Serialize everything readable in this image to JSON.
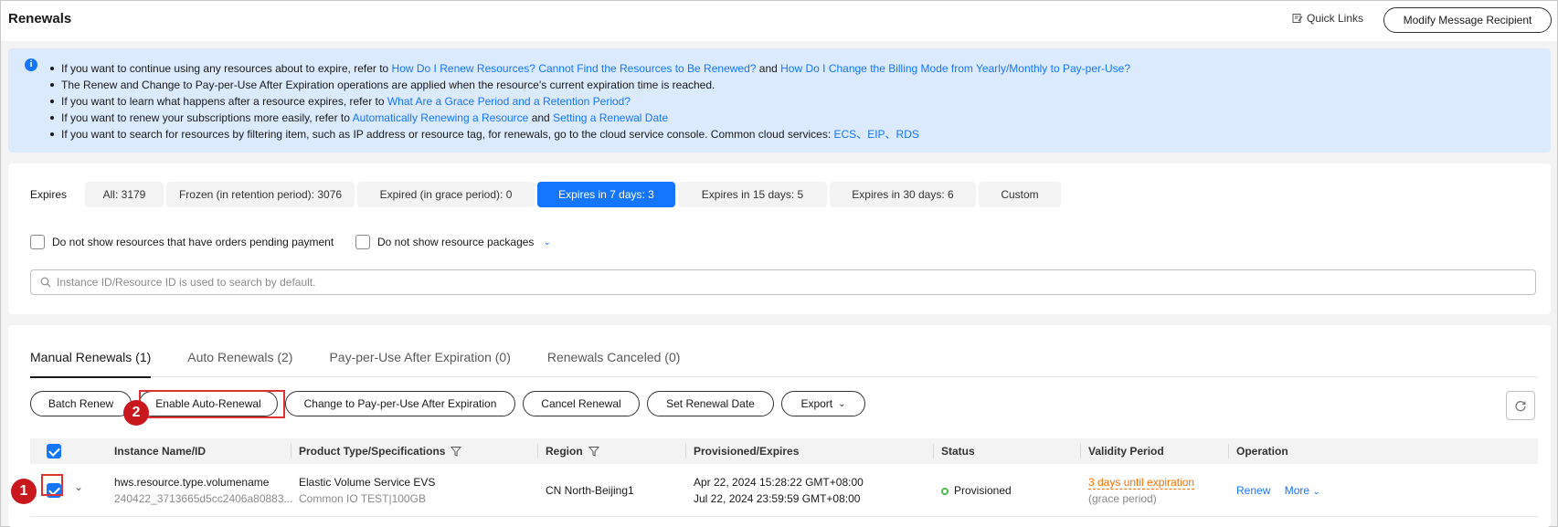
{
  "header": {
    "title": "Renewals",
    "quick_links": "Quick Links",
    "modify_recipient": "Modify Message Recipient"
  },
  "notice": {
    "line1_pre": "If you want to continue using any resources about to expire, refer to ",
    "line1_link1": "How Do I Renew Resources? Cannot Find the Resources to Be Renewed?",
    "line1_mid": " and ",
    "line1_link2": "How Do I Change the Billing Mode from Yearly/Monthly to Pay-per-Use?",
    "line2": "The Renew and Change to Pay-per-Use After Expiration operations are applied when the resource's current expiration time is reached.",
    "line3_pre": "If you want to learn what happens after a resource expires, refer to ",
    "line3_link": "What Are a Grace Period and a Retention Period?",
    "line4_pre": "If you want to renew your subscriptions more easily, refer to ",
    "line4_link1": "Automatically Renewing a Resource",
    "line4_mid": " and ",
    "line4_link2": "Setting a Renewal Date",
    "line5_pre": "If you want to search for resources by filtering item, such as IP address or resource tag, for renewals, go to the cloud service console. Common cloud services: ",
    "line5_links": "ECS、EIP、RDS"
  },
  "filters": {
    "expires_label": "Expires",
    "chips": [
      {
        "label": "All: 3179"
      },
      {
        "label": "Frozen (in retention period): 3076"
      },
      {
        "label": "Expired (in grace period): 0"
      },
      {
        "label": "Expires in 7 days: 3"
      },
      {
        "label": "Expires in 15 days: 5"
      },
      {
        "label": "Expires in 30 days: 6"
      },
      {
        "label": "Custom"
      }
    ],
    "option1": "Do not show resources that have orders pending payment",
    "option2": "Do not show resource packages",
    "search_placeholder": "Instance ID/Resource ID is used to search by default."
  },
  "tabs": [
    {
      "label": "Manual Renewals (1)"
    },
    {
      "label": "Auto Renewals (2)"
    },
    {
      "label": "Pay-per-Use After Expiration (0)"
    },
    {
      "label": "Renewals Canceled (0)"
    }
  ],
  "toolbar": {
    "batch_renew": "Batch Renew",
    "enable_auto_renewal": "Enable Auto-Renewal",
    "change_ppu": "Change to Pay-per-Use After Expiration",
    "cancel_renewal": "Cancel Renewal",
    "set_renewal_date": "Set Renewal Date",
    "export": "Export"
  },
  "table": {
    "columns": {
      "instance": "Instance Name/ID",
      "product": "Product Type/Specifications",
      "region": "Region",
      "provisioned": "Provisioned/Expires",
      "status": "Status",
      "validity": "Validity Period",
      "operation": "Operation"
    },
    "rows": [
      {
        "name": "hws.resource.type.volumename",
        "id": "240422_3713665d5cc2406a80883...",
        "product": "Elastic Volume Service EVS",
        "spec": "Common IO TEST|100GB",
        "region": "CN North-Beijing1",
        "provisioned": "Apr 22, 2024 15:28:22 GMT+08:00",
        "expires": "Jul 22, 2024 23:59:59 GMT+08:00",
        "status": "Provisioned",
        "validity": "3 days until expiration",
        "validity_note": "(grace period)",
        "renew": "Renew",
        "more": "More"
      }
    ]
  },
  "annotations": {
    "badge1": "1",
    "badge2": "2"
  },
  "colors": {
    "accent": "#1476ff",
    "highlight": "#e03131",
    "badge": "#c8181e",
    "warning": "#f66f00",
    "success": "#4fb84f"
  }
}
